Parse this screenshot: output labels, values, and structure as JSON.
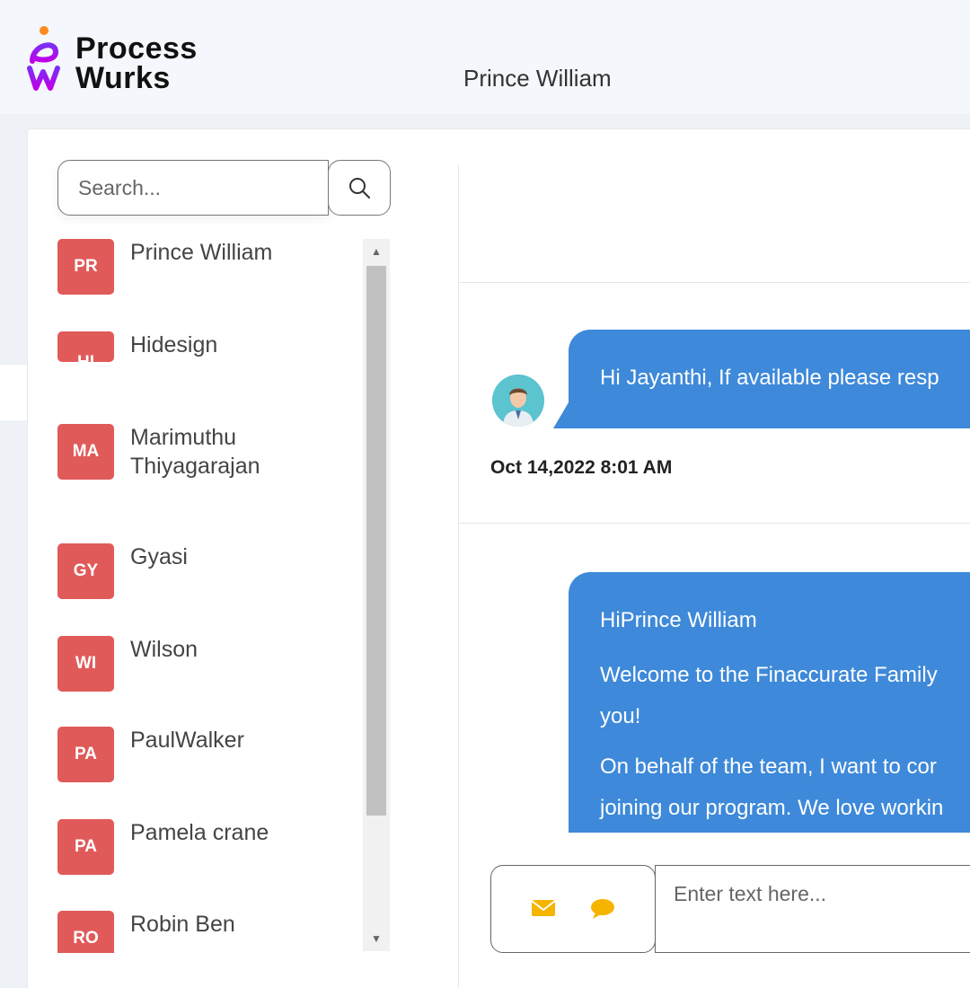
{
  "brand": {
    "line1": "Process",
    "line2": "Wurks"
  },
  "search": {
    "placeholder": "Search..."
  },
  "contacts": [
    {
      "initials": "PR",
      "name": "Prince William"
    },
    {
      "initials": "HI",
      "name": "Hidesign"
    },
    {
      "initials": "MA",
      "name": "Marimuthu Thiyagarajan"
    },
    {
      "initials": "GY",
      "name": "Gyasi"
    },
    {
      "initials": "WI",
      "name": "Wilson"
    },
    {
      "initials": "PA",
      "name": "PaulWalker"
    },
    {
      "initials": "PA",
      "name": "Pamela crane"
    },
    {
      "initials": "RO",
      "name": "Robin Ben"
    }
  ],
  "chat": {
    "title": "Prince William",
    "messages": [
      {
        "text": "Hi Jayanthi, If available please resp",
        "timestamp": "Oct 14,2022 8:01 AM"
      },
      {
        "greeting": "HiPrince William",
        "para1": "Welcome to the Finaccurate Family",
        "para1b": "you!",
        "para2": "On behalf of the team, I want to cor",
        "para2b": "joining our program. We love workin"
      }
    ]
  },
  "composer": {
    "placeholder": "Enter text here..."
  },
  "icons": [
    "search-icon",
    "envelope-icon",
    "chat-bubble-icon",
    "user-avatar-icon"
  ],
  "colors": {
    "accent": "#3e89d9",
    "avatar": "#e05a5a",
    "icon_yellow": "#f5b400"
  }
}
